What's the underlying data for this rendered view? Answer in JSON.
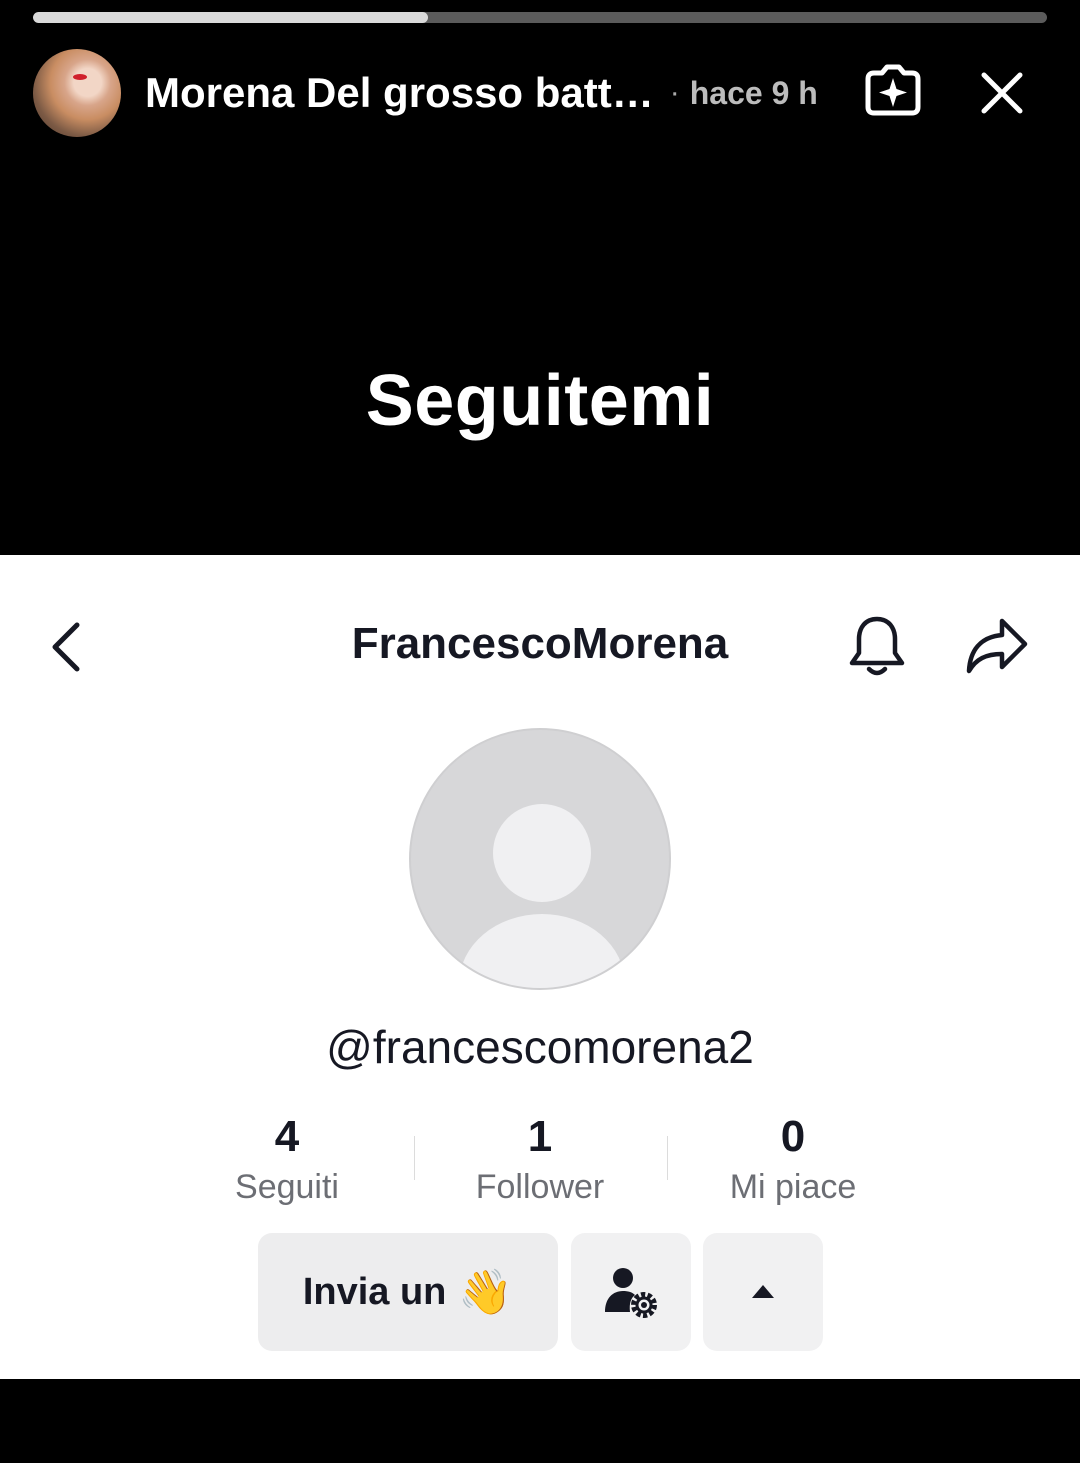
{
  "story": {
    "progress": 0.39,
    "author_name": "Morena Del grosso batt…",
    "separator": "·",
    "posted_time": "hace 9 h",
    "caption": "Seguitemi",
    "icons": {
      "avatar": "author-avatar",
      "effect": "sparkle-frame-icon",
      "close": "close-icon"
    }
  },
  "profile": {
    "title": "FrancescoMorena",
    "handle": "@francescomorena2",
    "stats": [
      {
        "value": "4",
        "label": "Seguiti"
      },
      {
        "value": "1",
        "label": "Follower"
      },
      {
        "value": "0",
        "label": "Mi piace"
      }
    ],
    "actions": {
      "wave_label": "Invia un",
      "wave_emoji": "👋",
      "manage_icon": "user-gear-icon",
      "more_icon": "caret-up-icon"
    },
    "icons": {
      "back": "chevron-left-icon",
      "bell": "bell-icon",
      "share": "share-arrow-icon"
    }
  }
}
